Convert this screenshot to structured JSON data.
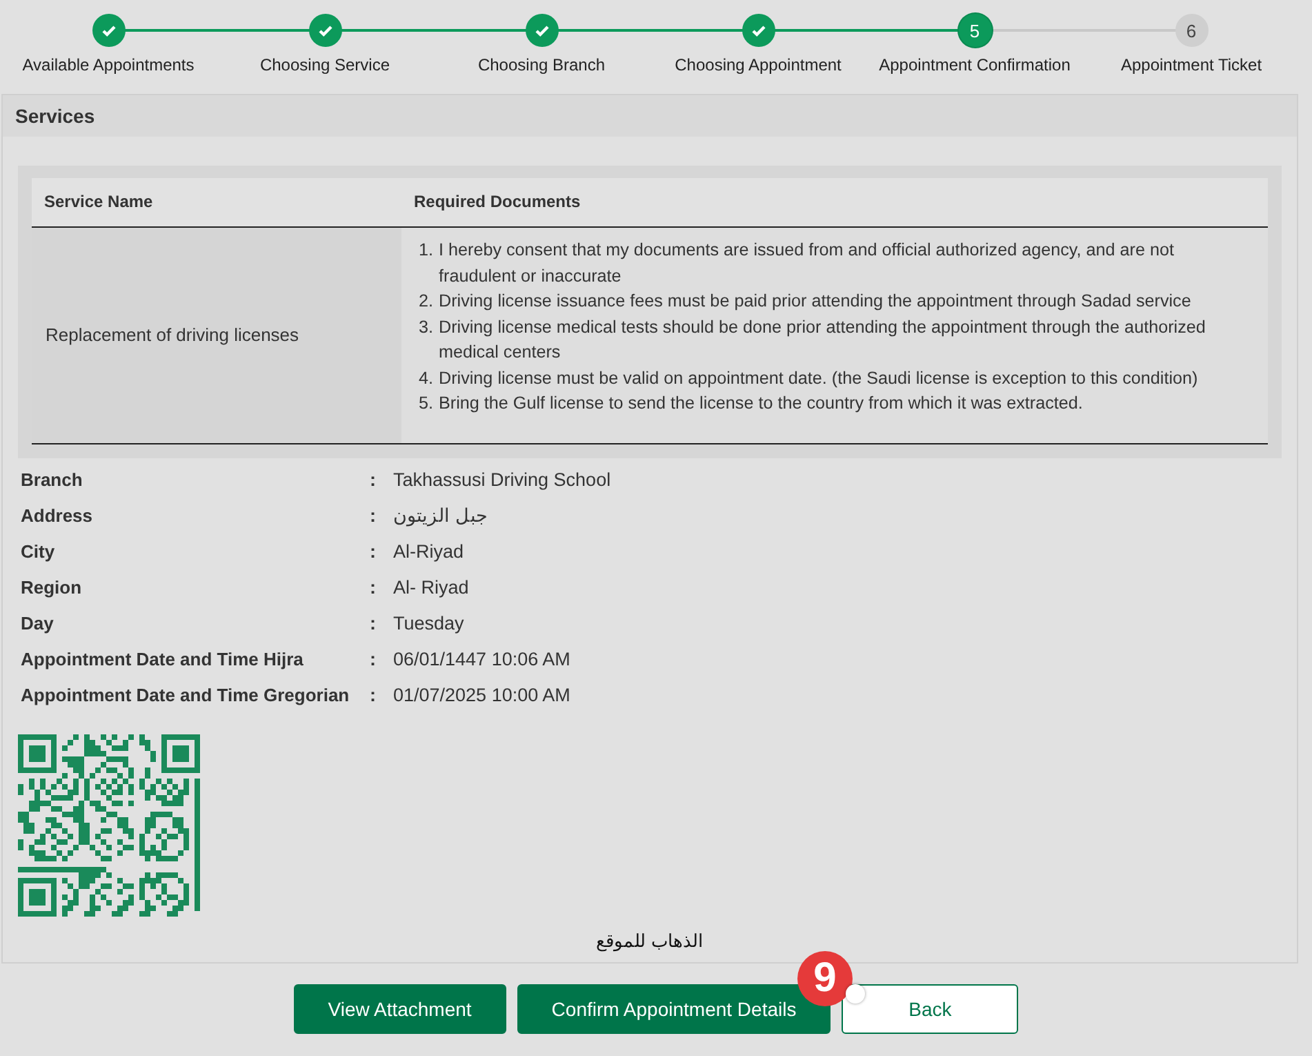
{
  "stepper": [
    {
      "label": "Available Appointments",
      "completed": true,
      "selected": false
    },
    {
      "label": "Choosing Service",
      "completed": true,
      "selected": false
    },
    {
      "label": "Choosing Branch",
      "completed": true,
      "selected": false
    },
    {
      "label": "Choosing Appointment",
      "completed": true,
      "selected": false
    },
    {
      "label": "Appointment Confirmation",
      "completed": false,
      "selected": true,
      "number": "5"
    },
    {
      "label": "Appointment Ticket",
      "completed": false,
      "selected": false,
      "number": "6"
    }
  ],
  "services": {
    "title": "Services",
    "table": {
      "columns": [
        "Service Name",
        "Required Documents"
      ],
      "rows": [
        {
          "service_name": "Replacement of driving licenses",
          "documents": [
            {
              "marker": "1.",
              "text": "I hereby consent that my documents are issued from and official authorized agency, and are not fraudulent or inaccurate"
            },
            {
              "marker": "2.",
              "text": "Driving license issuance fees must be paid prior attending the appointment through Sadad service"
            },
            {
              "marker": "3.",
              "text": "Driving license medical tests should be done prior attending the appointment through the authorized medical centers"
            },
            {
              "marker": "4.",
              "text": "Driving license must be valid on appointment date. (the Saudi license is exception to this condition)"
            },
            {
              "marker": "5.",
              "text": "Bring the Gulf license to send the license to the country from which it was extracted."
            }
          ]
        }
      ]
    }
  },
  "details": [
    {
      "label": "Branch",
      "separator": ":",
      "value": "Takhassusi Driving School"
    },
    {
      "label": "Address",
      "separator": ":",
      "value": "جبل الزيتون"
    },
    {
      "label": "City",
      "separator": ":",
      "value": "Al-Riyad"
    },
    {
      "label": "Region",
      "separator": ":",
      "value": "Al- Riyad"
    },
    {
      "label": "Day",
      "separator": ":",
      "value": "Tuesday"
    },
    {
      "label": "Appointment Date and Time Hijra",
      "separator": ":",
      "value": "06/01/1447 10:06 AM"
    },
    {
      "label": "Appointment Date and Time Gregorian",
      "separator": ":",
      "value": "01/07/2025 10:00 AM"
    }
  ],
  "location_link": "الذهاب للموقع",
  "buttons": [
    {
      "label": "View Attachment",
      "kind": "primary"
    },
    {
      "label": "Confirm Appointment Details",
      "kind": "primary"
    },
    {
      "label": "Back",
      "kind": "outline"
    }
  ],
  "annotation": {
    "number": "9"
  }
}
